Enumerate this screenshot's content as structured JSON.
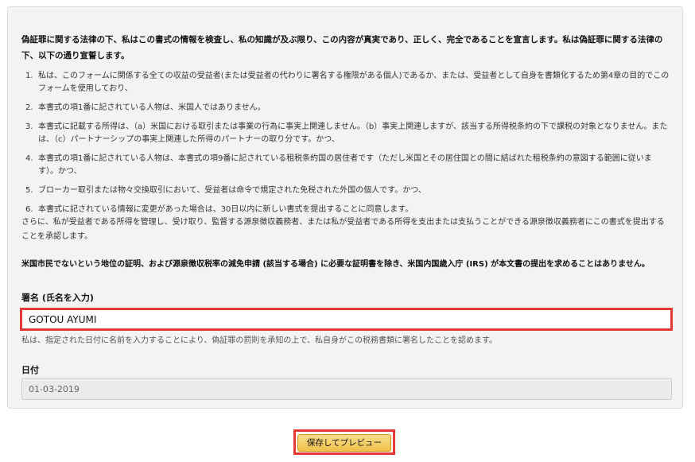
{
  "declaration": {
    "intro": "偽証罪に関する法律の下、私はこの書式の情報を検査し、私の知識が及ぶ限り、この内容が真実であり、正しく、完全であることを宣言します。私は偽証罪に関する法律の下、以下の通り宣誓します。",
    "items": [
      {
        "num": "1.",
        "text": "私は、このフォームに関係する全ての収益の受益者(または受益者の代わりに署名する権限がある個人)であるか、または、受益者として自身を書類化するため第4章の目的でこのフォームを使用しており、"
      },
      {
        "num": "2.",
        "text": "本書式の項1番に記されている人物は、米国人ではありません。"
      },
      {
        "num": "3.",
        "text": "本書式に記載する所得は、（a）米国における取引または事業の行為に事実上関連しません。（b）事実上関連しますが、該当する所得税条約の下で課税の対象となりません。または、（c）パートナーシップの事実上関連した所得のパートナーの取り分です。かつ、"
      },
      {
        "num": "4.",
        "text": "本書式の項1番に記されている人物は、本書式の項9番に記されている租税条約国の居住者です（ただし米国とその居住国との間に結ばれた租税条約の意図する範囲に従います）。かつ、"
      },
      {
        "num": "5.",
        "text": "ブローカー取引または物々交換取引において、受益者は命令で規定された免税された外国の個人です。かつ、"
      },
      {
        "num": "6.",
        "text": "本書式に記されている情報に変更があった場合は、30日以内に新しい書式を提出することに同意します。"
      }
    ],
    "after": "さらに、私が受益者である所得を管理し、受け取り、監督する源泉徴収義務者、または私が受益者である所得を支出または支払うことができる源泉徴収義務者にこの書式を提出することを承認します。",
    "notice": "米国市民でないという地位の証明、および源泉徴収税率の減免申請 (該当する場合) に必要な証明書を除き、米国内国歳入庁 (IRS) が本文書の提出を求めることはありません。"
  },
  "signature": {
    "label": "署名 (氏名を入力)",
    "value": "GOTOU AYUMI",
    "note": "私は、指定された日付に名前を入力することにより、偽証罪の罰則を承知の上で、私自身がこの税務書類に署名したことを認めます。"
  },
  "date": {
    "label": "日付",
    "value": "01-03-2019"
  },
  "actions": {
    "save_preview_label": "保存してプレビュー"
  },
  "colors": {
    "highlight": "#e53935",
    "button": "#f0c14b",
    "panel": "#f3f3f3"
  }
}
